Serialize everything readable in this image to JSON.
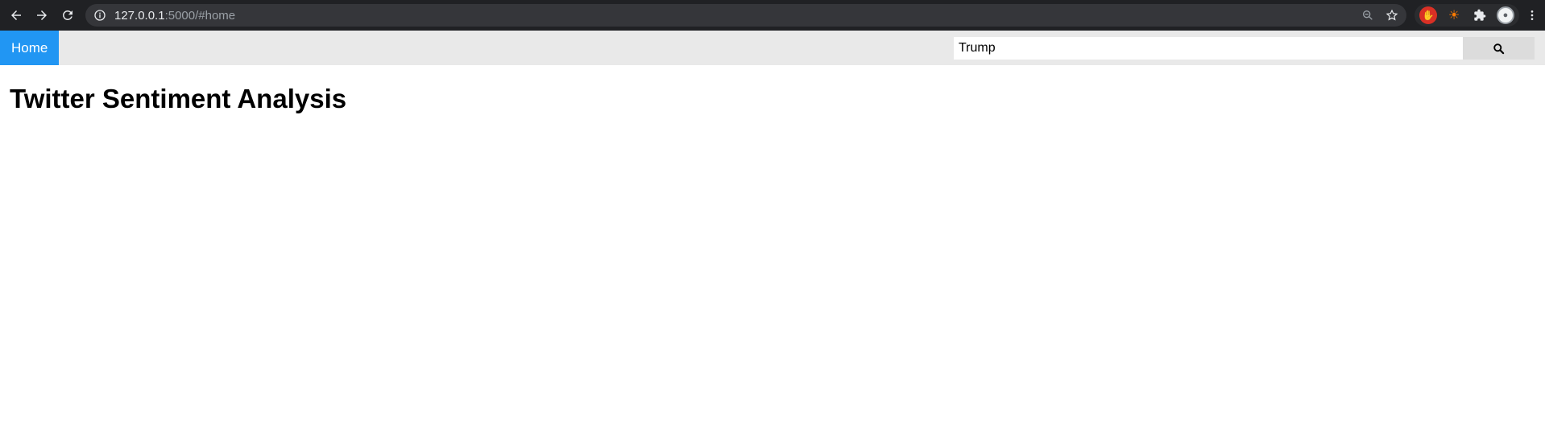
{
  "browser": {
    "url_host": "127.0.0.1",
    "url_rest": ":5000/#home",
    "icons": {
      "back": "arrow-left-icon",
      "forward": "arrow-right-icon",
      "reload": "reload-icon",
      "info": "info-icon",
      "zoom": "zoom-out-icon",
      "bookmark": "star-icon",
      "extensions": "puzzle-icon",
      "menu": "kebab-menu-icon"
    }
  },
  "topnav": {
    "home_label": "Home",
    "search": {
      "value": "Trump",
      "button_icon": "search-icon"
    },
    "accent_color": "#2196F3"
  },
  "main": {
    "title": "Twitter Sentiment Analysis"
  }
}
